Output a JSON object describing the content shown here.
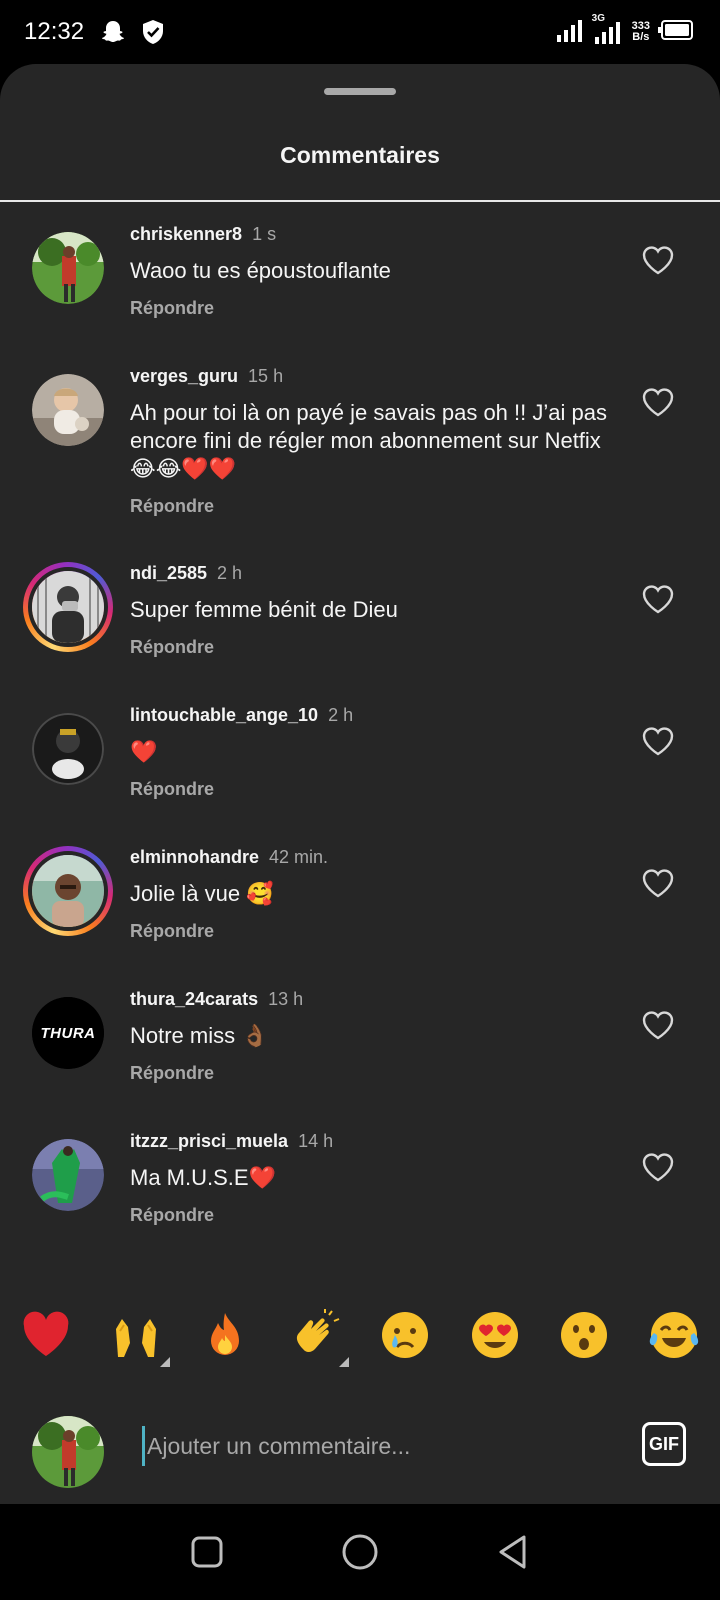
{
  "status_bar": {
    "time": "12:32",
    "network_type": "3G",
    "net_rate_value": "333",
    "net_rate_unit": "B/s",
    "icons": [
      "snapchat-icon",
      "shield-icon",
      "signal-icon",
      "signal-icon",
      "battery-icon"
    ]
  },
  "sheet": {
    "title": "Commentaires"
  },
  "comments": [
    {
      "username": "chriskenner8",
      "time": "1 s",
      "text": "Waoo tu es époustouflante",
      "reply_label": "Répondre"
    },
    {
      "username": "verges_guru",
      "time": "15 h",
      "text": "Ah pour toi là on payé je savais pas oh !! J’ai pas encore fini de régler mon abonnement sur Netfix 😂😂❤️❤️",
      "reply_label": "Répondre"
    },
    {
      "username": "ndi_2585",
      "time": "2 h",
      "text": "Super femme bénit de Dieu",
      "reply_label": "Répondre"
    },
    {
      "username": "lintouchable_ange_10",
      "time": "2 h",
      "text": "❤️",
      "reply_label": "Répondre"
    },
    {
      "username": "elminnohandre",
      "time": "42 min.",
      "text": "Jolie là vue 🥰",
      "reply_label": "Répondre"
    },
    {
      "username": "thura_24carats",
      "time": "13 h",
      "text": "Notre miss 👌🏾",
      "reply_label": "Répondre",
      "avatar_text": "THURA"
    },
    {
      "username": "itzzz_prisci_muela",
      "time": "14 h",
      "text": "Ma M.U.S.E❤️",
      "reply_label": "Répondre"
    }
  ],
  "quick_reactions": [
    "heart",
    "raising-hands",
    "fire",
    "clapping-hands",
    "crying-face",
    "heart-eyes-face",
    "surprised-face",
    "tears-of-joy-face"
  ],
  "composer": {
    "placeholder": "Ajouter un commentaire...",
    "gif_label": "GIF"
  },
  "colors": {
    "sheet_bg": "#262626",
    "text_primary": "#f5f5f5",
    "text_secondary": "#a8a8a8",
    "heart_red": "#e0242f"
  }
}
